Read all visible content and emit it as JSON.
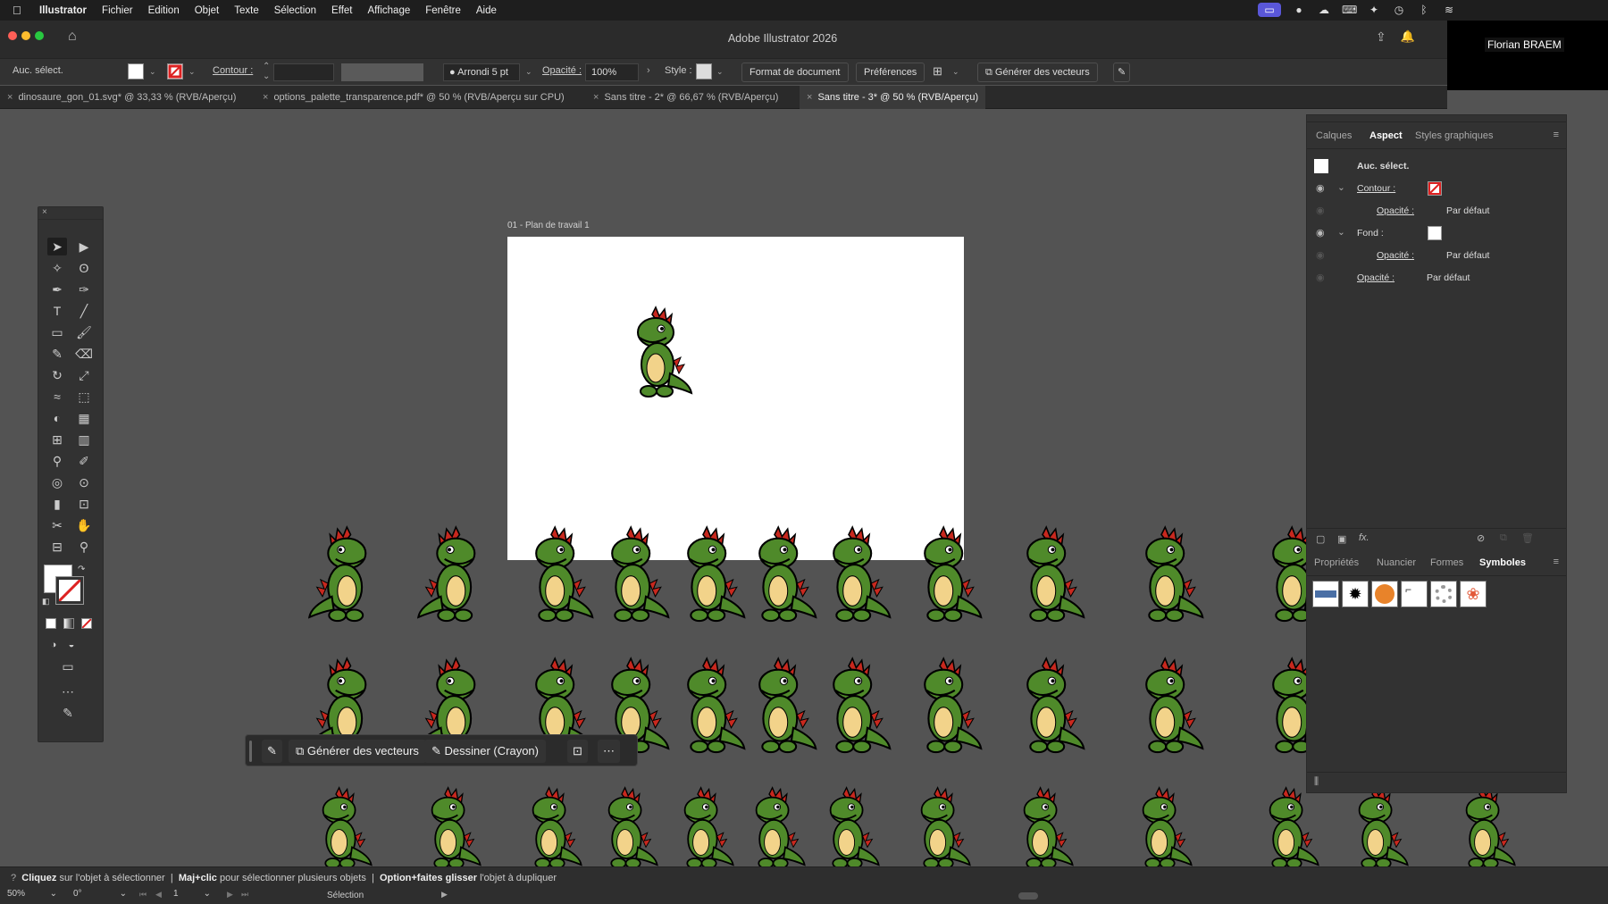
{
  "menubar": {
    "app": "Illustrator",
    "items": [
      "Fichier",
      "Edition",
      "Objet",
      "Texte",
      "Sélection",
      "Effet",
      "Affichage",
      "Fenêtre",
      "Aide"
    ]
  },
  "user": {
    "name": "Florian BRAEM"
  },
  "window": {
    "title": "Adobe Illustrator 2026"
  },
  "controlbar": {
    "selection": "Auc. sélect.",
    "contour_label": "Contour :",
    "brush": "Arrondi 5 pt",
    "opacity_label": "Opacité :",
    "opacity_value": "100%",
    "style_label": "Style :",
    "doc_format": "Format de document",
    "preferences": "Préférences",
    "generate_vectors": "Générer des vecteurs"
  },
  "tabs": [
    {
      "label": "dinosaure_gon_01.svg* @ 33,33 % (RVB/Aperçu)"
    },
    {
      "label": "options_palette_transparence.pdf* @ 50 % (RVB/Aperçu sur CPU)"
    },
    {
      "label": "Sans titre - 2* @ 66,67 % (RVB/Aperçu)"
    },
    {
      "label": "Sans titre - 3* @ 50 % (RVB/Aperçu)"
    }
  ],
  "artboard": {
    "label": "01 - Plan de travail 1"
  },
  "appearance_panel": {
    "tabs": [
      "Calques",
      "Aspect",
      "Styles graphiques"
    ],
    "selection": "Auc. sélect.",
    "contour": "Contour :",
    "fond": "Fond :",
    "opacity": "Opacité :",
    "default": "Par défaut"
  },
  "symbols_panel": {
    "tabs": [
      "Propriétés",
      "Nuancier",
      "Formes",
      "Symboles"
    ]
  },
  "context_bar": {
    "generate": "Générer des vecteurs",
    "draw": "Dessiner (Crayon)"
  },
  "status": {
    "hint1_b": "Cliquez",
    "hint1": "sur l'objet à sélectionner",
    "hint2_b": "Maj+clic",
    "hint2": "pour sélectionner plusieurs objets",
    "hint3_b": "Option+faites glisser",
    "hint3": "l'objet à dupliquer",
    "zoom": "50%",
    "rotation": "0°",
    "artboard_num": "1",
    "tool": "Sélection"
  },
  "colors": {
    "accent": "#5a57d9",
    "dino_green": "#4f8a2a",
    "dino_red": "#c8281e",
    "dino_belly": "#f2d38a"
  }
}
